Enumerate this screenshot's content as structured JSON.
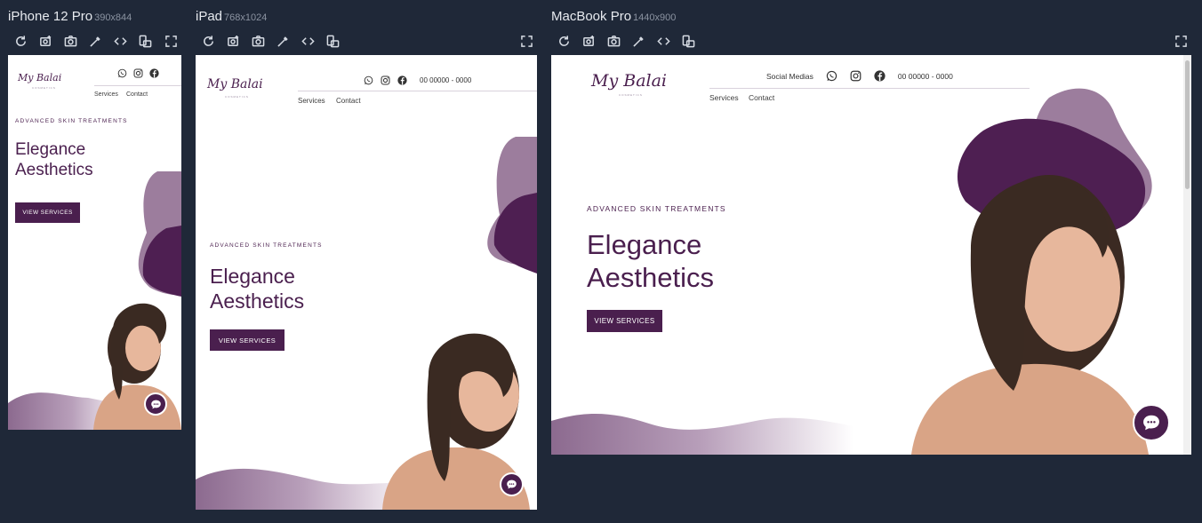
{
  "toolbar_icons": [
    "reload-icon",
    "screenshot-area-icon",
    "camera-icon",
    "eyedropper-icon",
    "code-icon",
    "rotate-icon"
  ],
  "devices": [
    {
      "name": "iPhone 12 Pro",
      "size": "390x844"
    },
    {
      "name": "iPad",
      "size": "768x1024"
    },
    {
      "name": "MacBook Pro",
      "size": "1440x900"
    }
  ],
  "site": {
    "logo": "My Balai",
    "logo_sub": "COSMETICS",
    "social_label": "Social Medias",
    "phone": "00 00000 - 0000",
    "nav": [
      "Services",
      "Contact"
    ],
    "eyebrow": "ADVANCED SKIN TREATMENTS",
    "headline_line1": "Elegance",
    "headline_line2": "Aesthetics",
    "cta": "VIEW SERVICES"
  },
  "colors": {
    "brand": "#4a1f4e",
    "brand_light": "#9c7d9d",
    "background": "#1f2838"
  }
}
